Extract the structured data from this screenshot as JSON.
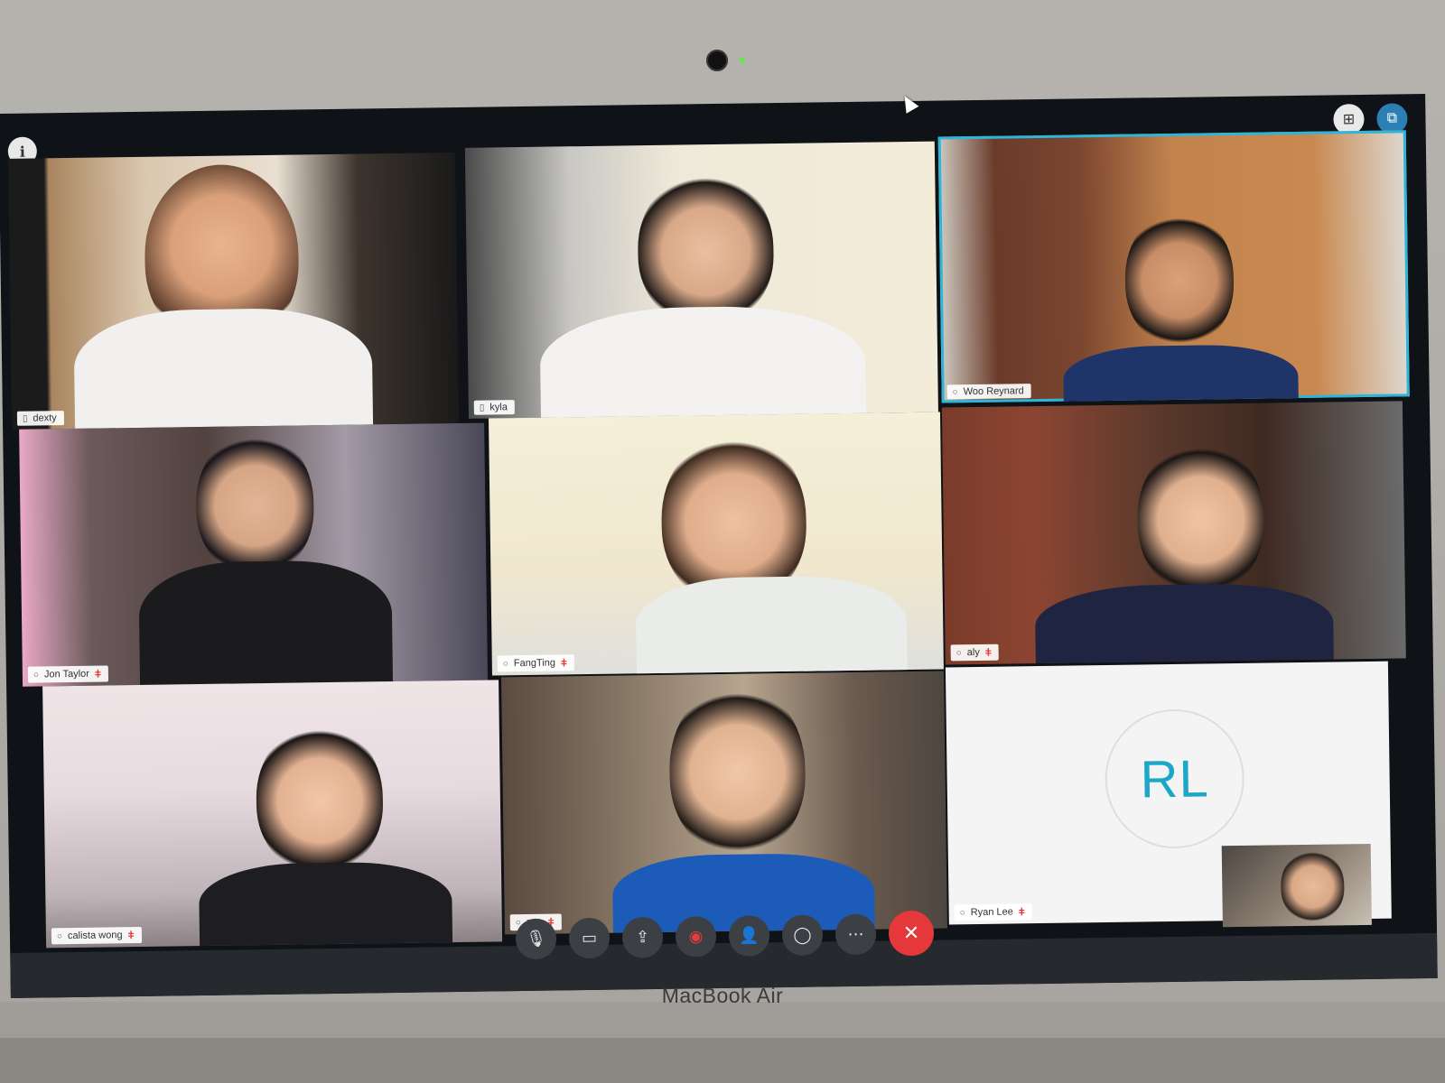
{
  "device": {
    "brand_label": "MacBook Air"
  },
  "participants": [
    {
      "name": "dexty",
      "muted": false
    },
    {
      "name": "kyla",
      "muted": false
    },
    {
      "name": "Woo Reynard",
      "muted": false,
      "active_speaker": true
    },
    {
      "name": "Jon Taylor",
      "muted": true
    },
    {
      "name": "FangTing",
      "muted": true
    },
    {
      "name": "aly",
      "muted": true
    },
    {
      "name": "calista wong",
      "muted": true
    },
    {
      "name": "zoe",
      "muted": true
    },
    {
      "name": "Ryan Lee",
      "muted": true,
      "initials": "RL"
    }
  ],
  "colors": {
    "accent": "#2fb5d8",
    "avatar_text": "#1aa7c8",
    "end_call": "#e5383b",
    "mute_indicator": "#e23b3b"
  },
  "icons": {
    "info": "info-icon",
    "grid_view": "grid-view-icon",
    "pop_out": "pop-out-icon",
    "mic": "microphone-icon",
    "mute": "mute-microphone-icon",
    "video": "video-camera-icon",
    "share": "share-screen-icon",
    "record": "record-icon",
    "participants": "participants-icon",
    "chat": "chat-icon",
    "more": "more-options-icon",
    "end": "end-call-icon"
  }
}
